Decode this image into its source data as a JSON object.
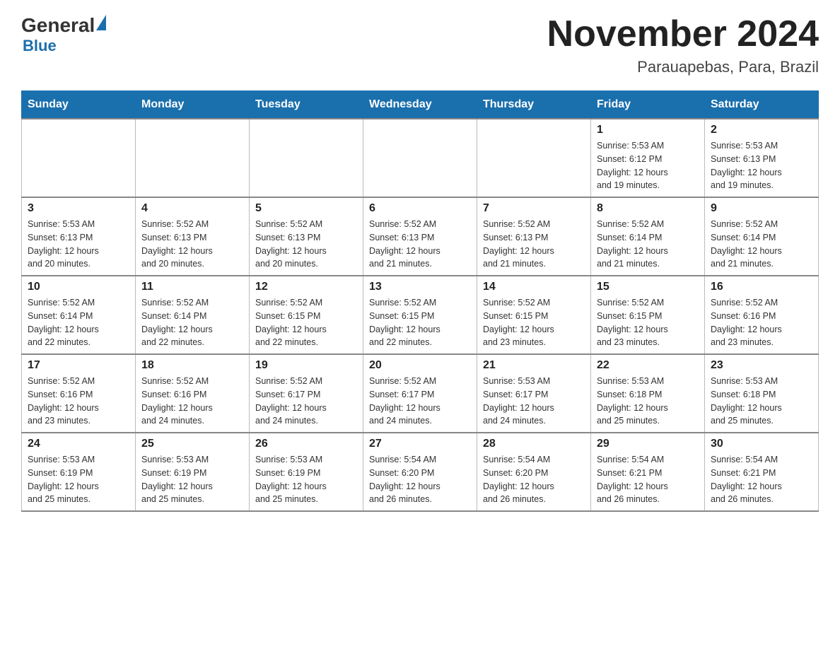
{
  "header": {
    "logo_text": "General",
    "logo_blue": "Blue",
    "month_title": "November 2024",
    "location": "Parauapebas, Para, Brazil"
  },
  "weekdays": [
    "Sunday",
    "Monday",
    "Tuesday",
    "Wednesday",
    "Thursday",
    "Friday",
    "Saturday"
  ],
  "weeks": [
    [
      {
        "day": "",
        "info": ""
      },
      {
        "day": "",
        "info": ""
      },
      {
        "day": "",
        "info": ""
      },
      {
        "day": "",
        "info": ""
      },
      {
        "day": "",
        "info": ""
      },
      {
        "day": "1",
        "info": "Sunrise: 5:53 AM\nSunset: 6:12 PM\nDaylight: 12 hours\nand 19 minutes."
      },
      {
        "day": "2",
        "info": "Sunrise: 5:53 AM\nSunset: 6:13 PM\nDaylight: 12 hours\nand 19 minutes."
      }
    ],
    [
      {
        "day": "3",
        "info": "Sunrise: 5:53 AM\nSunset: 6:13 PM\nDaylight: 12 hours\nand 20 minutes."
      },
      {
        "day": "4",
        "info": "Sunrise: 5:52 AM\nSunset: 6:13 PM\nDaylight: 12 hours\nand 20 minutes."
      },
      {
        "day": "5",
        "info": "Sunrise: 5:52 AM\nSunset: 6:13 PM\nDaylight: 12 hours\nand 20 minutes."
      },
      {
        "day": "6",
        "info": "Sunrise: 5:52 AM\nSunset: 6:13 PM\nDaylight: 12 hours\nand 21 minutes."
      },
      {
        "day": "7",
        "info": "Sunrise: 5:52 AM\nSunset: 6:13 PM\nDaylight: 12 hours\nand 21 minutes."
      },
      {
        "day": "8",
        "info": "Sunrise: 5:52 AM\nSunset: 6:14 PM\nDaylight: 12 hours\nand 21 minutes."
      },
      {
        "day": "9",
        "info": "Sunrise: 5:52 AM\nSunset: 6:14 PM\nDaylight: 12 hours\nand 21 minutes."
      }
    ],
    [
      {
        "day": "10",
        "info": "Sunrise: 5:52 AM\nSunset: 6:14 PM\nDaylight: 12 hours\nand 22 minutes."
      },
      {
        "day": "11",
        "info": "Sunrise: 5:52 AM\nSunset: 6:14 PM\nDaylight: 12 hours\nand 22 minutes."
      },
      {
        "day": "12",
        "info": "Sunrise: 5:52 AM\nSunset: 6:15 PM\nDaylight: 12 hours\nand 22 minutes."
      },
      {
        "day": "13",
        "info": "Sunrise: 5:52 AM\nSunset: 6:15 PM\nDaylight: 12 hours\nand 22 minutes."
      },
      {
        "day": "14",
        "info": "Sunrise: 5:52 AM\nSunset: 6:15 PM\nDaylight: 12 hours\nand 23 minutes."
      },
      {
        "day": "15",
        "info": "Sunrise: 5:52 AM\nSunset: 6:15 PM\nDaylight: 12 hours\nand 23 minutes."
      },
      {
        "day": "16",
        "info": "Sunrise: 5:52 AM\nSunset: 6:16 PM\nDaylight: 12 hours\nand 23 minutes."
      }
    ],
    [
      {
        "day": "17",
        "info": "Sunrise: 5:52 AM\nSunset: 6:16 PM\nDaylight: 12 hours\nand 23 minutes."
      },
      {
        "day": "18",
        "info": "Sunrise: 5:52 AM\nSunset: 6:16 PM\nDaylight: 12 hours\nand 24 minutes."
      },
      {
        "day": "19",
        "info": "Sunrise: 5:52 AM\nSunset: 6:17 PM\nDaylight: 12 hours\nand 24 minutes."
      },
      {
        "day": "20",
        "info": "Sunrise: 5:52 AM\nSunset: 6:17 PM\nDaylight: 12 hours\nand 24 minutes."
      },
      {
        "day": "21",
        "info": "Sunrise: 5:53 AM\nSunset: 6:17 PM\nDaylight: 12 hours\nand 24 minutes."
      },
      {
        "day": "22",
        "info": "Sunrise: 5:53 AM\nSunset: 6:18 PM\nDaylight: 12 hours\nand 25 minutes."
      },
      {
        "day": "23",
        "info": "Sunrise: 5:53 AM\nSunset: 6:18 PM\nDaylight: 12 hours\nand 25 minutes."
      }
    ],
    [
      {
        "day": "24",
        "info": "Sunrise: 5:53 AM\nSunset: 6:19 PM\nDaylight: 12 hours\nand 25 minutes."
      },
      {
        "day": "25",
        "info": "Sunrise: 5:53 AM\nSunset: 6:19 PM\nDaylight: 12 hours\nand 25 minutes."
      },
      {
        "day": "26",
        "info": "Sunrise: 5:53 AM\nSunset: 6:19 PM\nDaylight: 12 hours\nand 25 minutes."
      },
      {
        "day": "27",
        "info": "Sunrise: 5:54 AM\nSunset: 6:20 PM\nDaylight: 12 hours\nand 26 minutes."
      },
      {
        "day": "28",
        "info": "Sunrise: 5:54 AM\nSunset: 6:20 PM\nDaylight: 12 hours\nand 26 minutes."
      },
      {
        "day": "29",
        "info": "Sunrise: 5:54 AM\nSunset: 6:21 PM\nDaylight: 12 hours\nand 26 minutes."
      },
      {
        "day": "30",
        "info": "Sunrise: 5:54 AM\nSunset: 6:21 PM\nDaylight: 12 hours\nand 26 minutes."
      }
    ]
  ]
}
